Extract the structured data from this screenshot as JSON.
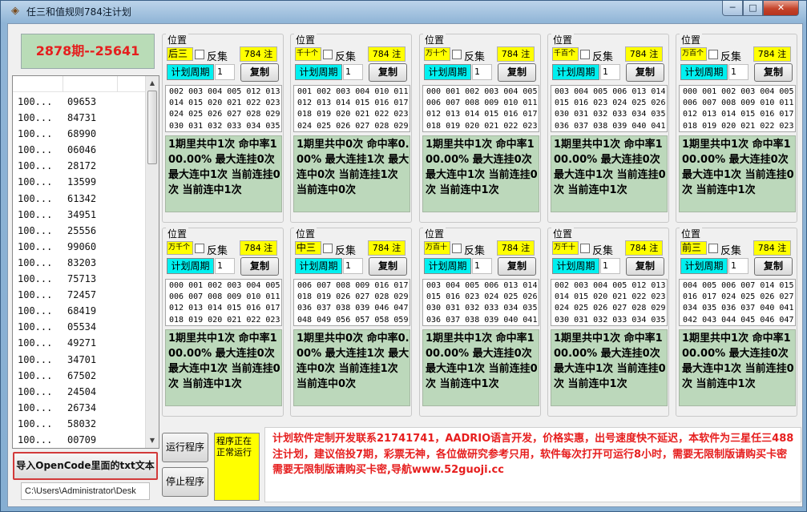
{
  "window": {
    "title": "任三和值规则784注计划",
    "min_glyph": "─",
    "max_glyph": "□",
    "close_glyph": "✕"
  },
  "period": "2878期--25641",
  "history": {
    "rows": [
      {
        "c1": "100...",
        "c2": "09653"
      },
      {
        "c1": "100...",
        "c2": "84731"
      },
      {
        "c1": "100...",
        "c2": "68990"
      },
      {
        "c1": "100...",
        "c2": "06046"
      },
      {
        "c1": "100...",
        "c2": "28172"
      },
      {
        "c1": "100...",
        "c2": "13599"
      },
      {
        "c1": "100...",
        "c2": "61342"
      },
      {
        "c1": "100...",
        "c2": "34951"
      },
      {
        "c1": "100...",
        "c2": "25556"
      },
      {
        "c1": "100...",
        "c2": "99060"
      },
      {
        "c1": "100...",
        "c2": "83203"
      },
      {
        "c1": "100...",
        "c2": "75713"
      },
      {
        "c1": "100...",
        "c2": "72457"
      },
      {
        "c1": "100...",
        "c2": "68419"
      },
      {
        "c1": "100...",
        "c2": "05534"
      },
      {
        "c1": "100...",
        "c2": "49271"
      },
      {
        "c1": "100...",
        "c2": "34701"
      },
      {
        "c1": "100...",
        "c2": "67502"
      },
      {
        "c1": "100...",
        "c2": "24504"
      },
      {
        "c1": "100...",
        "c2": "26734"
      },
      {
        "c1": "100...",
        "c2": "58032"
      },
      {
        "c1": "100...",
        "c2": "00709"
      }
    ]
  },
  "import_label": "导入OpenCode里面的txt文本",
  "path_value": "C:\\Users\\Administrator\\Desk",
  "groups": [
    {
      "label": "位置",
      "pos": "后三",
      "invert": "反集",
      "count": "784 注",
      "cycle_label": "计划周期",
      "cycle": "1",
      "copy": "复制",
      "nums": [
        "002 003 004 005 012 013",
        "014 015 020 021 022 023",
        "024 025 026 027 028 029",
        "030 031 032 033 034 035"
      ],
      "stats": "1期里共中1次 命中率100.00% 最大连挂0次 最大连中1次 当前连挂0次 当前连中1次"
    },
    {
      "label": "位置",
      "pos": "千十个",
      "invert": "反集",
      "count": "784 注",
      "cycle_label": "计划周期",
      "cycle": "1",
      "copy": "复制",
      "nums": [
        "001 002 003 004 010 011",
        "012 013 014 015 016 017",
        "018 019 020 021 022 023",
        "024 025 026 027 028 029"
      ],
      "stats": "1期里共中0次 命中率0.00% 最大连挂1次 最大连中0次 当前连挂1次 当前连中0次"
    },
    {
      "label": "位置",
      "pos": "万十个",
      "invert": "反集",
      "count": "784 注",
      "cycle_label": "计划周期",
      "cycle": "1",
      "copy": "复制",
      "nums": [
        "000 001 002 003 004 005",
        "006 007 008 009 010 011",
        "012 013 014 015 016 017",
        "018 019 020 021 022 023"
      ],
      "stats": "1期里共中1次 命中率100.00% 最大连挂0次 最大连中1次 当前连挂0次 当前连中1次"
    },
    {
      "label": "位置",
      "pos": "千百个",
      "invert": "反集",
      "count": "784 注",
      "cycle_label": "计划周期",
      "cycle": "1",
      "copy": "复制",
      "nums": [
        "003 004 005 006 013 014",
        "015 016 023 024 025 026",
        "030 031 032 033 034 035",
        "036 037 038 039 040 041"
      ],
      "stats": "1期里共中1次 命中率100.00% 最大连挂0次 最大连中1次 当前连挂0次 当前连中1次"
    },
    {
      "label": "位置",
      "pos": "万百个",
      "invert": "反集",
      "count": "784 注",
      "cycle_label": "计划周期",
      "cycle": "1",
      "copy": "复制",
      "nums": [
        "000 001 002 003 004 005",
        "006 007 008 009 010 011",
        "012 013 014 015 016 017",
        "018 019 020 021 022 023"
      ],
      "stats": "1期里共中1次 命中率100.00% 最大连挂0次 最大连中1次 当前连挂0次 当前连中1次"
    },
    {
      "label": "位置",
      "pos": "万千个",
      "invert": "反集",
      "count": "784 注",
      "cycle_label": "计划周期",
      "cycle": "1",
      "copy": "复制",
      "nums": [
        "000 001 002 003 004 005",
        "006 007 008 009 010 011",
        "012 013 014 015 016 017",
        "018 019 020 021 022 023"
      ],
      "stats": "1期里共中1次 命中率100.00% 最大连挂0次 最大连中1次 当前连挂0次 当前连中1次"
    },
    {
      "label": "位置",
      "pos": "中三",
      "invert": "反集",
      "count": "784 注",
      "cycle_label": "计划周期",
      "cycle": "1",
      "copy": "复制",
      "nums": [
        "006 007 008 009 016 017",
        "018 019 026 027 028 029",
        "036 037 038 039 046 047",
        "048 049 056 057 058 059"
      ],
      "stats": "1期里共中0次 命中率0.00% 最大连挂1次 最大连中0次 当前连挂1次 当前连中0次"
    },
    {
      "label": "位置",
      "pos": "万百十",
      "invert": "反集",
      "count": "784 注",
      "cycle_label": "计划周期",
      "cycle": "1",
      "copy": "复制",
      "nums": [
        "003 004 005 006 013 014",
        "015 016 023 024 025 026",
        "030 031 032 033 034 035",
        "036 037 038 039 040 041"
      ],
      "stats": "1期里共中1次 命中率100.00% 最大连挂0次 最大连中1次 当前连挂0次 当前连中1次"
    },
    {
      "label": "位置",
      "pos": "万千十",
      "invert": "反集",
      "count": "784 注",
      "cycle_label": "计划周期",
      "cycle": "1",
      "copy": "复制",
      "nums": [
        "002 003 004 005 012 013",
        "014 015 020 021 022 023",
        "024 025 026 027 028 029",
        "030 031 032 033 034 035"
      ],
      "stats": "1期里共中1次 命中率100.00% 最大连挂0次 最大连中1次 当前连挂0次 当前连中1次"
    },
    {
      "label": "位置",
      "pos": "前三",
      "invert": "反集",
      "count": "784 注",
      "cycle_label": "计划周期",
      "cycle": "1",
      "copy": "复制",
      "nums": [
        "004 005 006 007 014 015",
        "016 017 024 025 026 027",
        "034 035 036 037 040 041",
        "042 043 044 045 046 047"
      ],
      "stats": "1期里共中1次 命中率100.00% 最大连挂0次 最大连中1次 当前连挂0次 当前连中1次"
    }
  ],
  "run_label": "运行程序",
  "stop_label": "停止程序",
  "status_text": "程序正在正常运行",
  "ad_text": "计划软件定制开发联系21741741，AADRIO语言开发，价格实惠，出号速度快不延迟，本软件为三星任三488注计划，建议倍投7期，彩票无神，各位做研究参考只用，软件每次打开可运行8小时，需要无限制版请购买卡密需要无限制版请购买卡密,导航www.52guoji.cc"
}
